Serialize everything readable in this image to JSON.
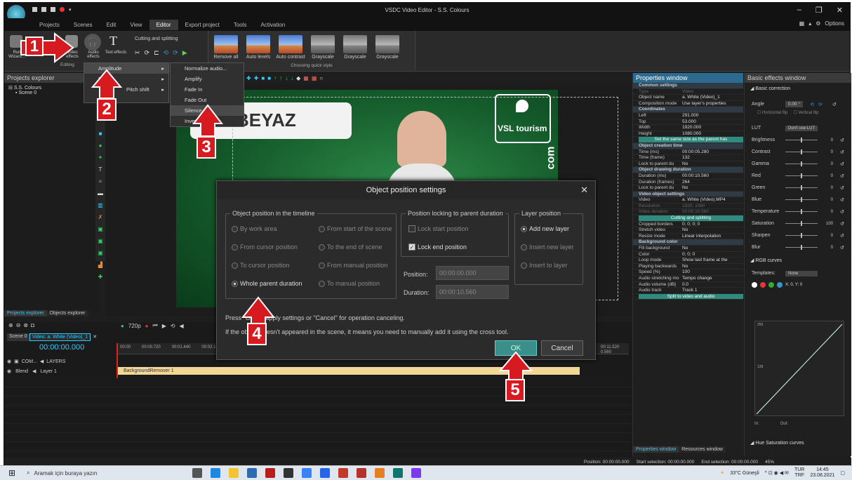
{
  "window": {
    "title": "VSDC Video Editor - S.S. Colours",
    "options": "Options"
  },
  "menu": [
    "Projects",
    "Scenes",
    "Edit",
    "View",
    "Editor",
    "Export project",
    "Tools",
    "Activation"
  ],
  "ribbon": {
    "buttons": [
      {
        "label": "Run Wizard...",
        "icon": "wizard-icon"
      },
      {
        "label": "Add object",
        "icon": "add-object-icon"
      },
      {
        "label": "Video effects",
        "icon": "video-effects-icon"
      },
      {
        "label": "Audio effects",
        "icon": "headphones-icon"
      },
      {
        "label": "Text effects",
        "icon": "text-effects-icon"
      }
    ],
    "cutting": "Cutting and splitting",
    "editing_label": "Editing",
    "quick_styles": [
      "Remove all",
      "Auto levels",
      "Auto contrast",
      "Grayscale",
      "Grayscale",
      "Grayscale"
    ],
    "quick_style_label": "Choosing quick style"
  },
  "left_panel": {
    "title": "Projects explorer",
    "tree": [
      "S.S. Colours",
      "Scene 0"
    ],
    "tabs": [
      "Projects explorer",
      "Objects explorer"
    ]
  },
  "audio_menu": {
    "items": [
      "Amplitude",
      "Delay",
      "Pitch shift"
    ],
    "highlight": "Amplitude"
  },
  "amplitude_menu": {
    "items": [
      "Normalize audio...",
      "Amplify",
      "Fade In",
      "Fade Out",
      "Silence",
      "Invert"
    ],
    "highlight": "Silence"
  },
  "preview": {
    "banner_text": "BEYAZ",
    "logo_text": "VSL tourism",
    "side_text": "com"
  },
  "dialog": {
    "title": "Object position settings",
    "group1_title": "Object position in the timeline",
    "group1_options": [
      {
        "label": "By work area",
        "on": false
      },
      {
        "label": "From start of the scene",
        "on": false
      },
      {
        "label": "From cursor position",
        "on": false
      },
      {
        "label": "To the end of scene",
        "on": false
      },
      {
        "label": "To cursor position",
        "on": false
      },
      {
        "label": "From manual position",
        "on": false
      },
      {
        "label": "Whole parent duration",
        "on": true
      },
      {
        "label": "To manual position",
        "on": false
      }
    ],
    "group2_title": "Position locking to parent duration",
    "lock_start": "Lock start position",
    "lock_end": "Lock end position",
    "position_label": "Position:",
    "position_value": "00:00:00.000",
    "duration_label": "Duration:",
    "duration_value": "00:00:10.560",
    "group3_title": "Layer position",
    "layer_options": [
      {
        "label": "Add new layer",
        "on": true
      },
      {
        "label": "Insert new layer",
        "on": false
      },
      {
        "label": "Insert to layer",
        "on": false
      }
    ],
    "hint1": "Press \"OK\" to apply settings or \"Cancel\" for operation canceling.",
    "hint2": "If the object doesn't appeared in the scene, it means you need to manually add it using the cross tool.",
    "ok": "OK",
    "cancel": "Cancel"
  },
  "timeline": {
    "tab": "Scene 0",
    "tab2": "Video: a. White (Video)_1",
    "time": "00:00:00.000",
    "zoom": "720p",
    "layers_label": "LAYERS",
    "com_label": "COM...",
    "blend": "Blend",
    "layer": "Layer 1",
    "clip": "BackgroundRemover 1",
    "ruler": [
      "00:00",
      "00:00.720",
      "00:01.440",
      "00:02.1"
    ],
    "ruler_right": [
      "00:11.520",
      "0.560"
    ]
  },
  "properties": {
    "title": "Properties window",
    "rows": [
      {
        "k": "Common settings",
        "v": "",
        "t": "sec"
      },
      {
        "k": "Type",
        "v": "Video",
        "t": "dim"
      },
      {
        "k": "Object name",
        "v": "a. White (Video)_1",
        "t": ""
      },
      {
        "k": "Composition mode",
        "v": "Use layer's properties",
        "t": ""
      },
      {
        "k": "Coordinates",
        "v": "",
        "t": "sec"
      },
      {
        "k": "Left",
        "v": "291.000",
        "t": ""
      },
      {
        "k": "Top",
        "v": "53.000",
        "t": ""
      },
      {
        "k": "Width",
        "v": "1920.000",
        "t": ""
      },
      {
        "k": "Height",
        "v": "1080.000",
        "t": ""
      },
      {
        "k": "",
        "v": "Set the same size as the parent has",
        "t": "btn"
      },
      {
        "k": "Object creation time",
        "v": "",
        "t": "sec"
      },
      {
        "k": "Time (ms)",
        "v": "00:00:05.280",
        "t": ""
      },
      {
        "k": "Time (frame)",
        "v": "132",
        "t": ""
      },
      {
        "k": "Lock to parent du",
        "v": "No",
        "t": ""
      },
      {
        "k": "Object drawing duration",
        "v": "",
        "t": "sec"
      },
      {
        "k": "Duration (ms)",
        "v": "00:00:10.560",
        "t": ""
      },
      {
        "k": "Duration (frames)",
        "v": "264",
        "t": ""
      },
      {
        "k": "Lock to parent du",
        "v": "No",
        "t": ""
      },
      {
        "k": "Video object settings",
        "v": "",
        "t": "sec"
      },
      {
        "k": "Video",
        "v": "a. White (Video).MP4",
        "t": ""
      },
      {
        "k": "Resolution",
        "v": "1920; 1080",
        "t": "dim"
      },
      {
        "k": "Video duration",
        "v": "00:00:10.560",
        "t": "dim"
      },
      {
        "k": "",
        "v": "Cutting and splitting",
        "t": "btn"
      },
      {
        "k": "Cropped borders",
        "v": "0; 0; 0; 0",
        "t": ""
      },
      {
        "k": "Stretch video",
        "v": "No",
        "t": ""
      },
      {
        "k": "Resize mode",
        "v": "Linear interpolation",
        "t": ""
      },
      {
        "k": "Background color",
        "v": "",
        "t": "sec"
      },
      {
        "k": "Fill background",
        "v": "No",
        "t": ""
      },
      {
        "k": "Color",
        "v": "0; 0; 0",
        "t": ""
      },
      {
        "k": "Loop mode",
        "v": "Show last frame at the",
        "t": ""
      },
      {
        "k": "Playing backwards",
        "v": "No",
        "t": ""
      },
      {
        "k": "Speed (%)",
        "v": "100",
        "t": ""
      },
      {
        "k": "Audio stretching mo",
        "v": "Tempo change",
        "t": ""
      },
      {
        "k": "Audio volume (dB)",
        "v": "0.0",
        "t": ""
      },
      {
        "k": "Audio track",
        "v": "Track 1",
        "t": ""
      },
      {
        "k": "",
        "v": "Split to video and audio",
        "t": "btn"
      }
    ],
    "tabs": [
      "Properties window",
      "Resources window"
    ]
  },
  "effects": {
    "title": "Basic effects window",
    "section": "Basic correction",
    "angle_label": "Angle",
    "angle_value": "0.00 °",
    "flip_h": "Horizontal flip",
    "flip_v": "Vertical flip",
    "lut_label": "LUT",
    "lut_value": "Don't use LUT",
    "sliders": [
      {
        "name": "Brightness",
        "value": "0"
      },
      {
        "name": "Contrast",
        "value": "0"
      },
      {
        "name": "Gamma",
        "value": "0"
      },
      {
        "name": "Red",
        "value": "0"
      },
      {
        "name": "Green",
        "value": "0"
      },
      {
        "name": "Blue",
        "value": "0"
      },
      {
        "name": "Temperature",
        "value": "0"
      },
      {
        "name": "Saturation",
        "value": "100"
      },
      {
        "name": "Sharpen",
        "value": "0"
      },
      {
        "name": "Blur",
        "value": "0"
      }
    ],
    "rgb_section": "RGB curves",
    "templates_label": "Templates:",
    "templates_value": "None",
    "xy": "X: 0, Y: 0",
    "curve_top": "255",
    "curve_mid": "128",
    "in_label": "In:",
    "out_label": "Out:",
    "hue_section": "Hue Saturation curves"
  },
  "statusbar": {
    "position": "Position:  00:00:00.000",
    "start": "Start selection:  00:00:00.000",
    "end": "End selection:  00:00:00.000",
    "zoom": "45%"
  },
  "taskbar": {
    "search": "Aramak için buraya yazın",
    "weather": "33°C  Güneşli",
    "lang": "TUR",
    "lang2": "TRF",
    "time": "14:45",
    "date": "23.08.2021"
  },
  "badges": [
    "1",
    "2",
    "3",
    "4",
    "5"
  ]
}
